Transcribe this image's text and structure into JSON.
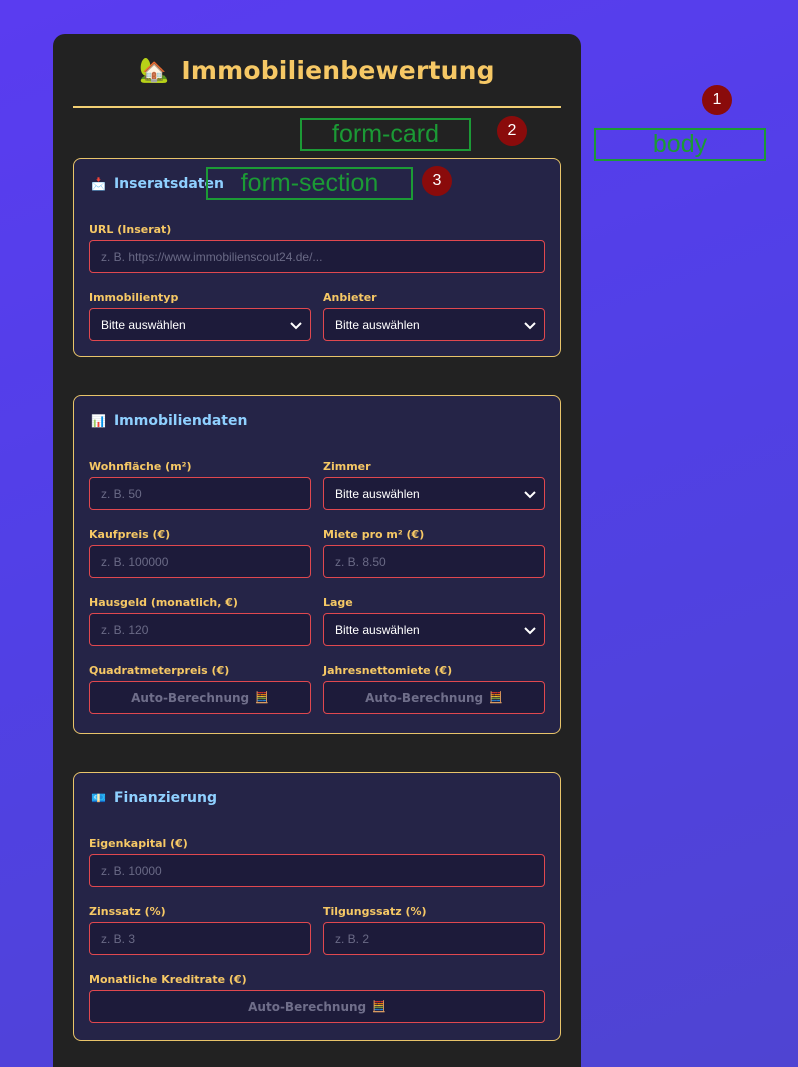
{
  "form": {
    "title": "Immobilienbewertung",
    "title_icon": "🏡"
  },
  "sections": {
    "listing": {
      "heading": "Inseratsdaten",
      "icon": "📩",
      "url_label": "URL (Inserat)",
      "url_placeholder": "z. B. https://www.immobilienscout24.de/...",
      "type_label": "Immobilientyp",
      "type_value": "Bitte auswählen",
      "provider_label": "Anbieter",
      "provider_value": "Bitte auswählen"
    },
    "property": {
      "heading": "Immobiliendaten",
      "icon": "📊",
      "area_label": "Wohnfläche (m²)",
      "area_placeholder": "z. B. 50",
      "rooms_label": "Zimmer",
      "rooms_value": "Bitte auswählen",
      "price_label": "Kaufpreis (€)",
      "price_placeholder": "z. B. 100000",
      "rent_label": "Miete pro m² (€)",
      "rent_placeholder": "z. B. 8.50",
      "fee_label": "Hausgeld (monatlich, €)",
      "fee_placeholder": "z. B. 120",
      "location_label": "Lage",
      "location_value": "Bitte auswählen",
      "sqm_price_label": "Quadratmeterpreis (€)",
      "sqm_price_value": "Auto-Berechnung",
      "annual_rent_label": "Jahresnettomiete (€)",
      "annual_rent_value": "Auto-Berechnung",
      "calc_icon": "🧮"
    },
    "financing": {
      "heading": "Finanzierung",
      "icon": "💶",
      "equity_label": "Eigenkapital (€)",
      "equity_placeholder": "z. B. 10000",
      "interest_label": "Zinssatz (%)",
      "interest_placeholder": "z. B. 3",
      "repayment_label": "Tilgungssatz (%)",
      "repayment_placeholder": "z. B. 2",
      "monthly_rate_label": "Monatliche Kreditrate (€)",
      "monthly_rate_value": "Auto-Berechnung",
      "calc_icon": "🧮"
    }
  },
  "annotations": {
    "body_label": "body",
    "body_marker": "1",
    "card_label": "form-card",
    "card_marker": "2",
    "section_label": "form-section",
    "section_marker": "3"
  },
  "colors": {
    "background": "#5a3cf0",
    "card": "#222222",
    "accent": "#f6c865",
    "section_heading": "#8fd0ff",
    "input_border": "#e0484f",
    "annotation": "#1b9a35",
    "marker": "#8a0b0b"
  }
}
